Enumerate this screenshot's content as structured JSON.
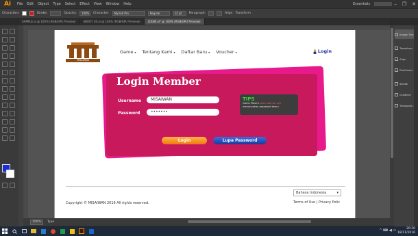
{
  "app": {
    "logo": "Ai",
    "menu": [
      "File",
      "Edit",
      "Object",
      "Type",
      "Select",
      "Effect",
      "View",
      "Window",
      "Help"
    ],
    "workspace": "Essentials",
    "window_controls": [
      "–",
      "❐",
      "✕"
    ]
  },
  "controlbar": {
    "label": "Characters",
    "stroke_label": "Stroke:",
    "opacity_label": "Opacity:",
    "opacity_value": "100%",
    "character_label": "Character:",
    "font": "Myriad Pro",
    "style": "Regular",
    "size": "12 pt",
    "paragraph_label": "Paragraph:",
    "align_label": "Align",
    "transform_label": "Transform"
  },
  "tabs": [
    {
      "label": "SAMPLE.ai @ 100% (RGB/GPU Preview)",
      "active": false
    },
    {
      "label": "ABOUT US.ai @ 100% (RGB/GPU Preview)",
      "active": false
    },
    {
      "label": "LOGIN.ai* @ 100% (RGB/GPU Preview)",
      "active": true
    }
  ],
  "panels": [
    {
      "label": "Image Trace",
      "icon": "image-trace-icon"
    },
    {
      "label": "Transform",
      "icon": "transform-icon"
    },
    {
      "label": "Align",
      "icon": "align-icon"
    },
    {
      "label": "Pathfinder",
      "icon": "pathfinder-icon"
    },
    {
      "label": "Stroke",
      "icon": "stroke-icon"
    },
    {
      "label": "Gradient",
      "icon": "gradient-icon"
    },
    {
      "label": "Transpare...",
      "icon": "transparency-icon"
    }
  ],
  "page": {
    "logo_tagline": "MISAIWAN",
    "nav": [
      "Game",
      "Tentang Kami",
      "Daftar Baru",
      "Voucher"
    ],
    "login_link": "Login",
    "card": {
      "title": "Login Member",
      "username_label": "Username",
      "username_value": "MISAIWAN",
      "password_label": "Password",
      "password_value": "•••••••",
      "tips_title": "TIPS",
      "tips_prefix": "Game Plasmi",
      "tips_highlight": "never ask for any",
      "tips_rest": "menanyakan password kamu",
      "login_button": "Login",
      "forgot_button": "Lupa Password"
    },
    "footer": {
      "copyright": "Copyright © MISAIWAN 2016 All rights reserved.",
      "language": "Bahasa Indonesia",
      "terms": "Terms of Use | Privacy Polic"
    }
  },
  "status": {
    "zoom": "100%",
    "tool": "Type"
  },
  "taskbar": {
    "time": "20:20",
    "date": "18/11/2016",
    "tray": "^ ⌨ ◀ ▭"
  },
  "colors": {
    "card": "#c8195c",
    "card_back": "#e8198a",
    "login_btn": "#f07a10",
    "forgot_btn": "#1a3a9c",
    "tips_title": "#36d636",
    "fill": "#1a2bd8"
  }
}
